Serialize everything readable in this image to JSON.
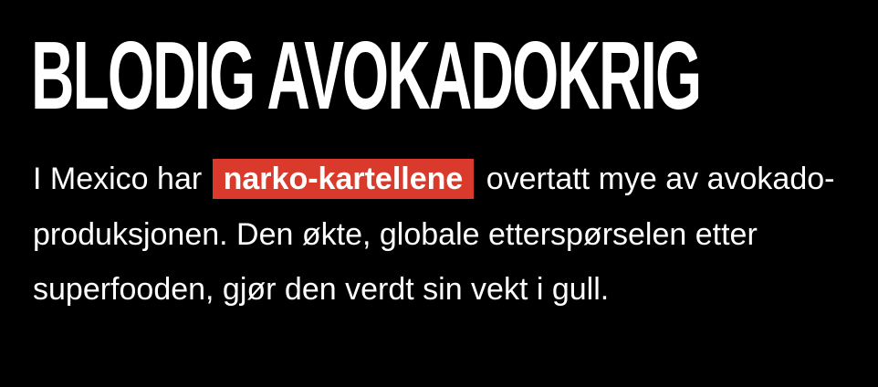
{
  "headline": "BLODIG AVOKADOKRIG",
  "body": {
    "before_highlight": "I Mexico har ",
    "highlight": "narko-kartellene",
    "after_highlight": " overtatt mye av avokado-produksjonen. Den økte, globale etterspørselen etter superfooden, gjør den verdt sin vekt i gull."
  },
  "colors": {
    "background": "#000000",
    "text": "#ffffff",
    "highlight_background": "#d93a2b"
  }
}
